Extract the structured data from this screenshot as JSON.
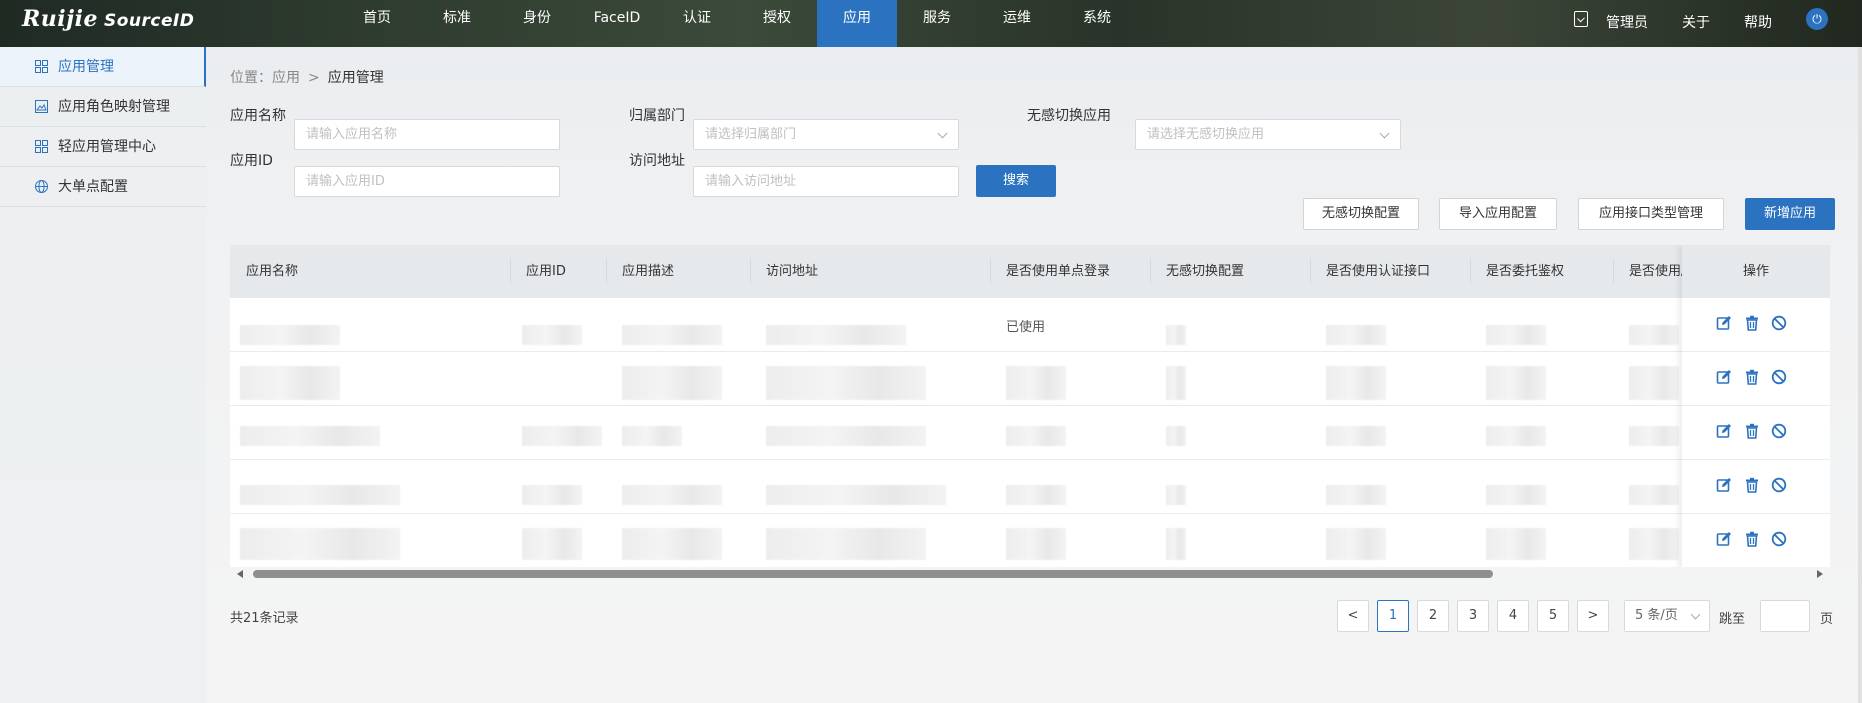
{
  "app": {
    "brand": "Ruijie",
    "product": "SourceID"
  },
  "nav": [
    "首页",
    "标准",
    "身份",
    "FaceID",
    "认证",
    "授权",
    "应用",
    "服务",
    "运维",
    "系统"
  ],
  "nav_active_index": 6,
  "top_right": {
    "admin": "管理员",
    "about": "关于",
    "help": "帮助"
  },
  "sidebar": {
    "items": [
      {
        "label": "应用管理",
        "icon": "grid-icon",
        "active": true
      },
      {
        "label": "应用角色映射管理",
        "icon": "image-icon",
        "active": false
      },
      {
        "label": "轻应用管理中心",
        "icon": "grid-icon",
        "active": false
      },
      {
        "label": "大单点配置",
        "icon": "globe-icon",
        "active": false
      }
    ]
  },
  "breadcrumb": {
    "prefix": "位置：",
    "parent": "应用",
    "separator": ">",
    "current": "应用管理"
  },
  "filters": {
    "app_name_label": "应用名称",
    "app_name_placeholder": "请输入应用名称",
    "dept_label": "归属部门",
    "dept_placeholder": "请选择归属部门",
    "seamless_label": "无感切换应用",
    "seamless_placeholder": "请选择无感切换应用",
    "app_id_label": "应用ID",
    "app_id_placeholder": "请输入应用ID",
    "url_label": "访问地址",
    "url_placeholder": "请输入访问地址",
    "search_button": "搜索"
  },
  "actions": {
    "seamless_config": "无感切换配置",
    "import_config": "导入应用配置",
    "interface_type": "应用接口类型管理",
    "add_app": "新增应用"
  },
  "table": {
    "columns": [
      "应用名称",
      "应用ID",
      "应用描述",
      "访问地址",
      "是否使用单点登录",
      "无感切换配置",
      "是否使用认证接口",
      "是否委托鉴权",
      "是否使用/"
    ],
    "ops_header": "操作",
    "first_row_sso": "已使用",
    "row_count": 5,
    "op_icons": [
      "edit-icon",
      "delete-icon",
      "disable-icon"
    ]
  },
  "pagination": {
    "total": "共21条记录",
    "pages": [
      "1",
      "2",
      "3",
      "4",
      "5"
    ],
    "current_page": "1",
    "prev": "<",
    "next": ">",
    "page_size": "5 条/页",
    "jump_to": "跳至",
    "page_suffix": "页"
  },
  "colors": {
    "primary": "#2b73c0",
    "header_bg": "#e6e9ec"
  }
}
